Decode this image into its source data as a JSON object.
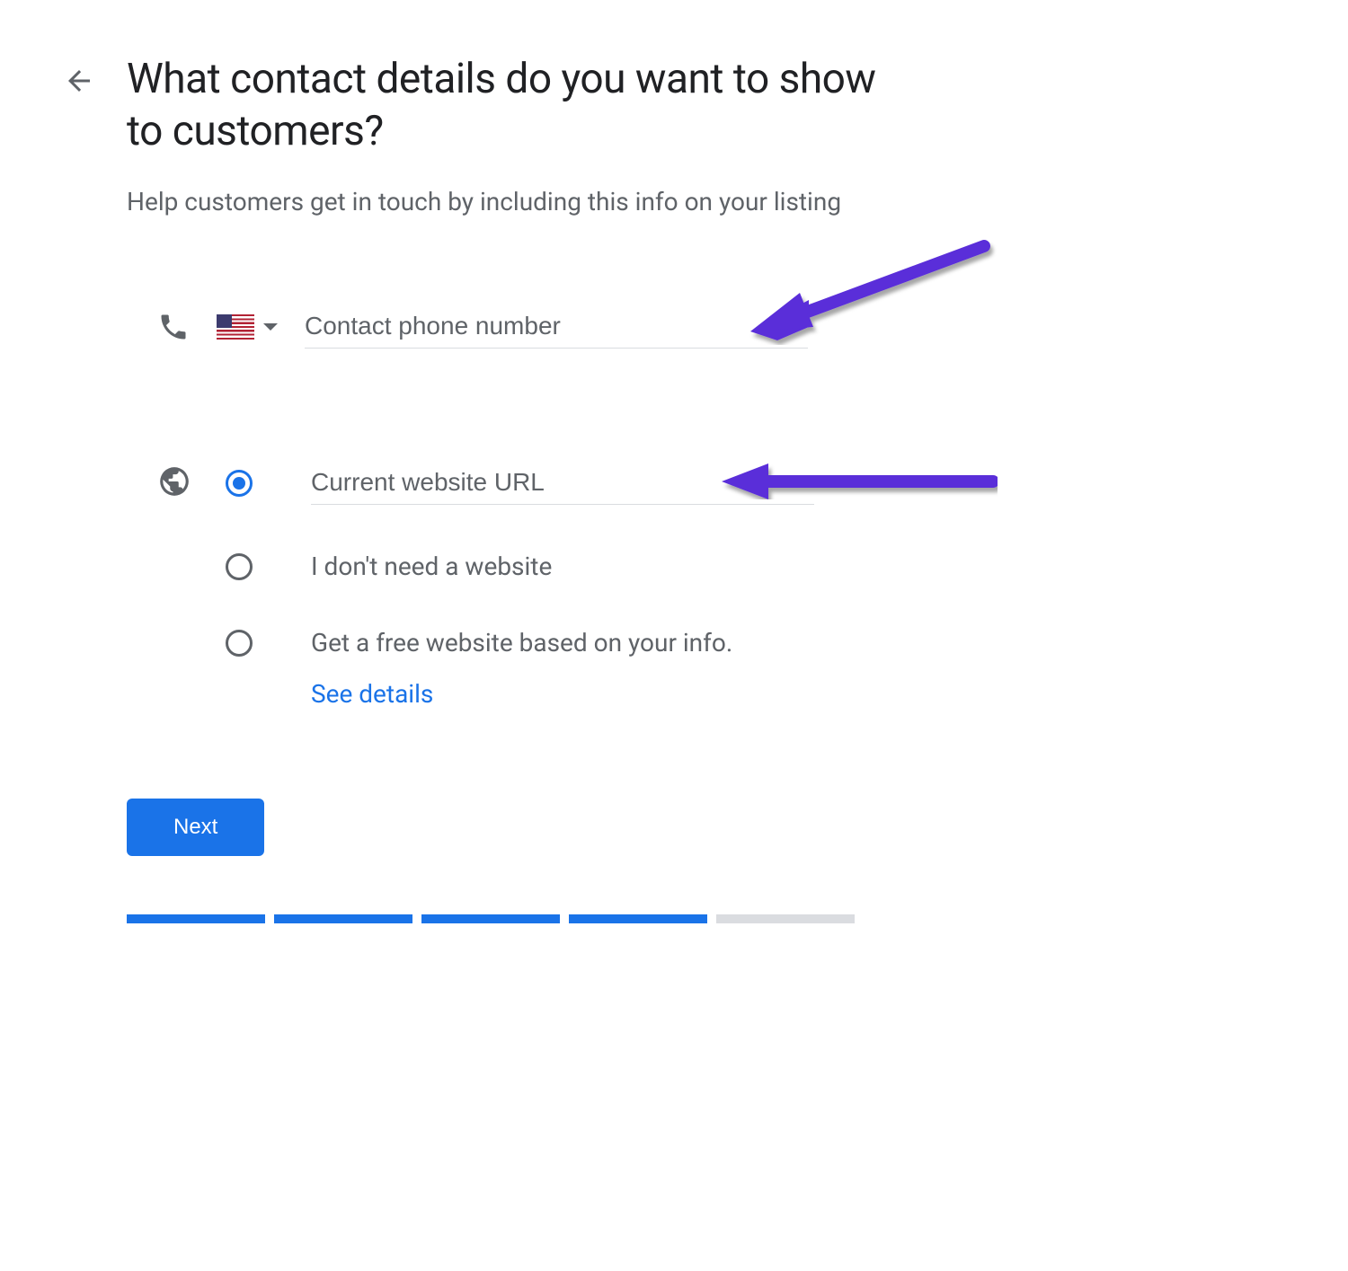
{
  "header": {
    "title": "What contact details do you want to show to customers?",
    "subtitle": "Help customers get in touch by including this info on your listing"
  },
  "phone": {
    "placeholder": "Contact phone number",
    "value": "",
    "country": "US"
  },
  "website": {
    "options": [
      {
        "label": "Current website URL",
        "selected": true,
        "is_input": true,
        "placeholder": "Current website URL",
        "value": ""
      },
      {
        "label": "I don't need a website",
        "selected": false
      },
      {
        "label": "Get a free website based on your info.",
        "selected": false
      }
    ],
    "see_details_label": "See details"
  },
  "buttons": {
    "next": "Next"
  },
  "progress": {
    "total": 5,
    "completed": 4
  },
  "annotation": {
    "arrow_color": "#5a2fd9"
  }
}
